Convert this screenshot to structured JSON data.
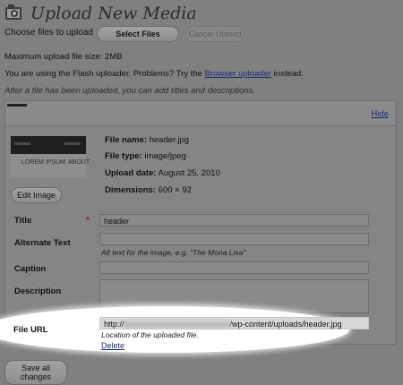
{
  "page": {
    "title": "Upload New Media"
  },
  "upload": {
    "choose_label": "Choose files to upload",
    "select_files": "Select Files",
    "cancel_upload": "Cancel Upload",
    "max_size": "Maximum upload file size: 2MB",
    "flash_prefix": "You are using the Flash uploader. Problems? Try the ",
    "browser_uploader": "Browser uploader",
    "flash_suffix": " instead.",
    "after_upload_note": "After a file has been uploaded, you can add titles and descriptions."
  },
  "item": {
    "hide": "Hide",
    "thumbnail": {
      "left_text": "LOREM IPSUM",
      "right_text": "ABOUT"
    },
    "edit_image": "Edit Image",
    "file_name_label": "File name:",
    "file_name": "header.jpg",
    "file_type_label": "File type:",
    "file_type": "image/jpeg",
    "upload_date_label": "Upload date:",
    "upload_date": "August 25, 2010",
    "dimensions_label": "Dimensions:",
    "dimensions": "600 × 92"
  },
  "form": {
    "title_label": "Title",
    "required_mark": "*",
    "title_value": "header",
    "alt_label": "Alternate Text",
    "alt_help": "Alt text for the image, e.g. “The Mona Lisa”",
    "caption_label": "Caption",
    "description_label": "Description",
    "url_label": "File URL",
    "url_prefix": "http://",
    "url_suffix": "/wp-content/uploads/header.jpg",
    "url_help": "Location of the uploaded file.",
    "delete": "Delete"
  },
  "footer": {
    "save_all": "Save all changes"
  }
}
